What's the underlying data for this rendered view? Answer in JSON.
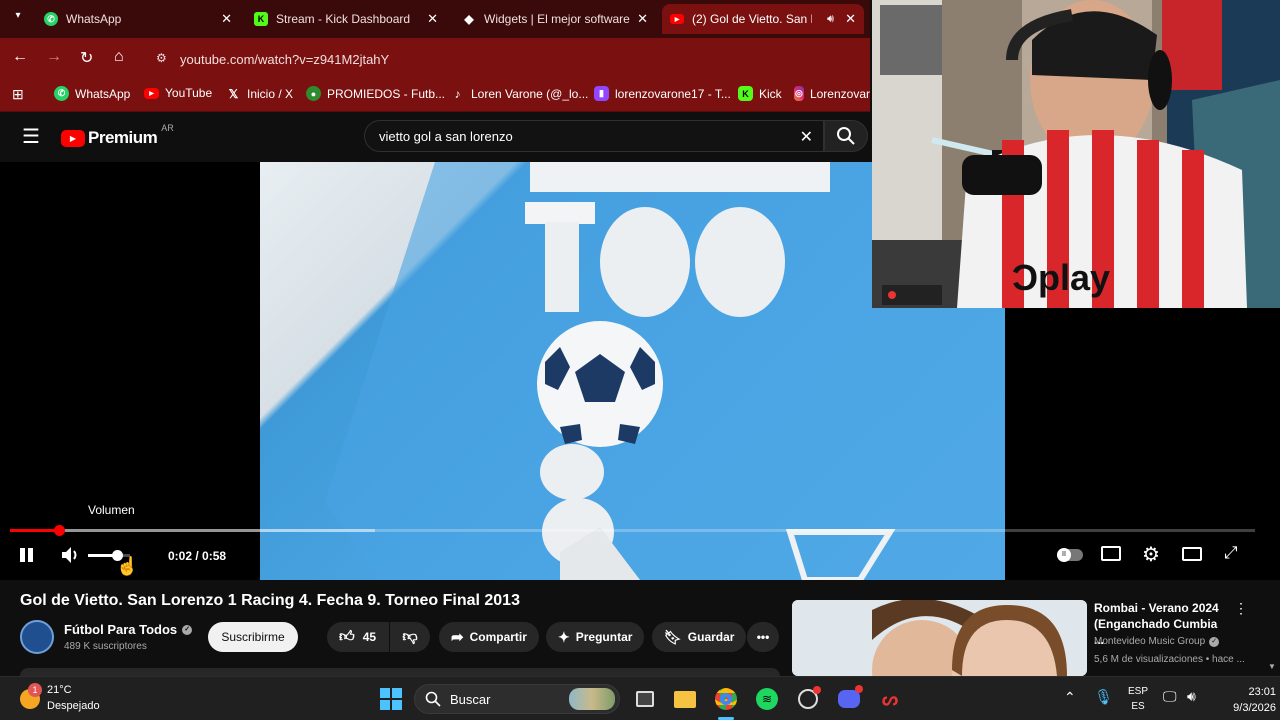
{
  "browser": {
    "tabs": [
      {
        "title": "WhatsApp",
        "icon": "whatsapp-icon",
        "color": "#25D366"
      },
      {
        "title": "Stream - Kick Dashboard",
        "icon": "kick-icon",
        "color": "#53FC18"
      },
      {
        "title": "Widgets | El mejor software",
        "icon": "widget-icon",
        "color": "#ffffff"
      },
      {
        "title": "(2) Gol de Vietto. San Lo",
        "icon": "youtube-icon",
        "color": "#FF0000"
      }
    ],
    "address": "youtube.com/watch?v=z941M2jtahY",
    "bookmarks": [
      {
        "label": "WhatsApp",
        "icon": "whatsapp-icon"
      },
      {
        "label": "YouTube",
        "icon": "youtube-icon"
      },
      {
        "label": "Inicio / X",
        "icon": "x-icon"
      },
      {
        "label": "PROMIEDOS - Futb...",
        "icon": "promiedos-icon"
      },
      {
        "label": "Loren Varone (@_lo...",
        "icon": "tiktok-icon"
      },
      {
        "label": "lorenzovarone17 - T...",
        "icon": "twitch-icon"
      },
      {
        "label": "Kick",
        "icon": "kick-icon"
      },
      {
        "label": "Lorenzovar",
        "icon": "instagram-icon"
      }
    ]
  },
  "youtube": {
    "logo": "Premium",
    "region": "AR",
    "search_query": "vietto gol a san lorenzo"
  },
  "player": {
    "tooltip": "Volumen",
    "time": "0:02 / 0:58",
    "progress_fraction": 0.039,
    "buffer_fraction": 0.293,
    "volume_fraction": 0.7
  },
  "video": {
    "title": "Gol de Vietto. San Lorenzo 1 Racing 4. Fecha 9. Torneo Final 2013",
    "channel": "Fútbol Para Todos",
    "subscribers": "489 K suscriptores",
    "subscribe_label": "Suscribirme",
    "likes": "45",
    "share_label": "Compartir",
    "ask_label": "Preguntar",
    "save_label": "Guardar"
  },
  "recommendation": {
    "title": "Rombai - Verano 2024 (Enganchado Cumbia ...",
    "channel": "Montevideo Music Group",
    "meta": "5,6 M de visualizaciones • hace ..."
  },
  "taskbar": {
    "weather_temp": "21°C",
    "weather_desc": "Despejado",
    "weather_badge": "1",
    "search_label": "Buscar",
    "lang_top": "ESP",
    "lang_bottom": "ES",
    "time": "23:01",
    "date": "9/3/2026"
  }
}
